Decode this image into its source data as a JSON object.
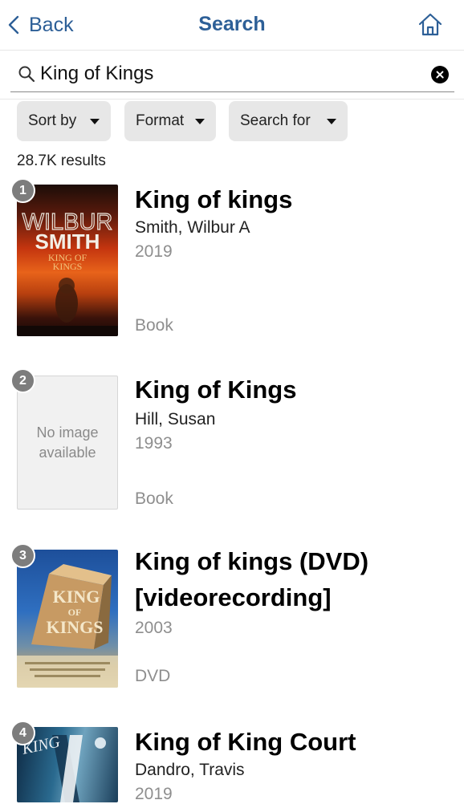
{
  "nav": {
    "back_label": "Back",
    "title": "Search"
  },
  "search": {
    "value": "King of Kings"
  },
  "filters": [
    {
      "label": "Sort by"
    },
    {
      "label": "Format"
    },
    {
      "label": "Search for"
    }
  ],
  "results_count": "28.7K results",
  "results": [
    {
      "rank": "1",
      "title": "King of kings",
      "author": "Smith, Wilbur A",
      "year": "2019",
      "format": "Book",
      "cover": {
        "line1": "WILBUR",
        "line2": "SMITH",
        "line3": "KING OF",
        "line4": "KINGS"
      }
    },
    {
      "rank": "2",
      "title": "King of Kings",
      "author": "Hill, Susan",
      "year": "1993",
      "format": "Book",
      "no_image_text": "No image available"
    },
    {
      "rank": "3",
      "title": "King of kings (DVD) [videorecording]",
      "author": "",
      "year": "2003",
      "format": "DVD",
      "cover": {
        "line1": "KING",
        "line2": "OF",
        "line3": "KINGS"
      }
    },
    {
      "rank": "4",
      "title": "King of King Court",
      "author": "Dandro, Travis",
      "year": "2019",
      "format": "",
      "cover": {
        "line1": "KING"
      }
    }
  ]
}
